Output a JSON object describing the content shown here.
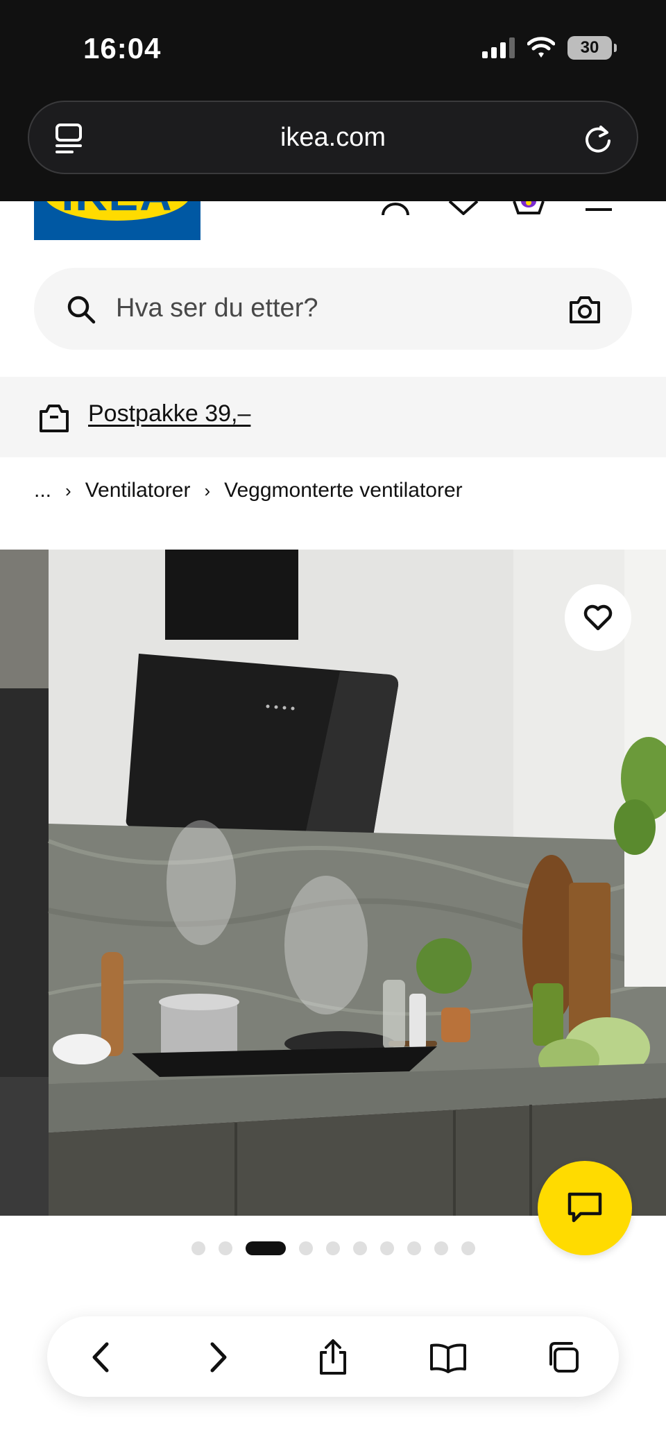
{
  "status_bar": {
    "time": "16:04",
    "battery": "30",
    "icons": [
      "cellular-signal-icon",
      "wifi-icon",
      "battery-icon"
    ]
  },
  "browser": {
    "url": "ikea.com",
    "left_icon": "reader-menu-icon",
    "right_icon": "reload-icon"
  },
  "header": {
    "logo_text": "IKEA",
    "icons": [
      "account-icon",
      "wishlist-heart-icon",
      "cart-icon",
      "menu-icon"
    ]
  },
  "search": {
    "placeholder": "Hva ser du etter?",
    "value": ""
  },
  "promo": {
    "label": "Postpakke 39,–",
    "icon": "parcel-icon"
  },
  "breadcrumb": {
    "ellipsis": "...",
    "items": [
      "Ventilatorer",
      "Veggmonterte ventilatorer"
    ]
  },
  "carousel": {
    "total": 10,
    "active_index": 2
  },
  "colors": {
    "ikea_blue": "#0058a3",
    "ikea_yellow": "#ffdb00",
    "light_gray": "#f5f5f5"
  },
  "toolbar": {
    "icons": [
      "back-icon",
      "forward-icon",
      "share-icon",
      "bookmarks-icon",
      "tabs-icon"
    ]
  }
}
